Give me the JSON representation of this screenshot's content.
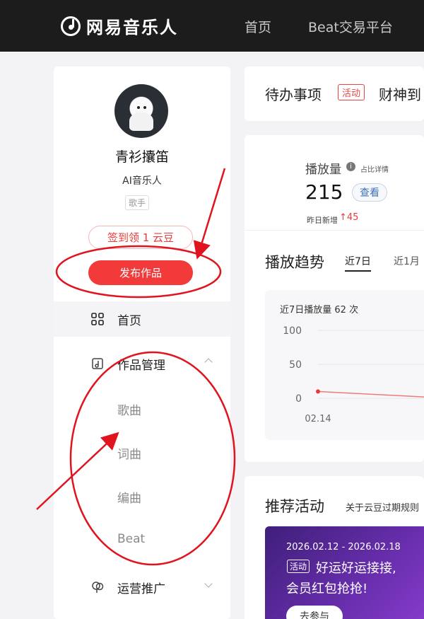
{
  "header": {
    "brand": "网易音乐人",
    "nav": [
      "首页",
      "Beat交易平台"
    ]
  },
  "profile": {
    "name": "青衫攮笛",
    "title": "AI音乐人",
    "role_tag": "歌手",
    "checkin_label": "签到领 1 云豆",
    "publish_label": "发布作品"
  },
  "menu": {
    "home": "首页",
    "works": "作品管理",
    "works_items": [
      "歌曲",
      "词曲",
      "编曲",
      "Beat"
    ],
    "promo": "运营推广"
  },
  "todo": {
    "title": "待办事项",
    "tag": "活动",
    "text": "财神到"
  },
  "stats": {
    "label": "播放量",
    "detail_link": "占比详情",
    "value": "215",
    "view_button": "查看",
    "yesterday_label": "昨日新增",
    "yesterday_value": "45"
  },
  "trend": {
    "title": "播放趋势",
    "tabs": [
      "近7日",
      "近1月"
    ],
    "caption": "近7日播放量 62 次"
  },
  "chart_data": {
    "type": "line",
    "title": "近7日播放量 62 次",
    "x": [
      "02.14"
    ],
    "series": [
      {
        "values": [
          10
        ]
      }
    ],
    "ylim": [
      0,
      100
    ],
    "yticks": [
      "100",
      "50",
      "0"
    ],
    "grid": true,
    "color": "#f07a7a"
  },
  "recommend": {
    "title": "推荐活动",
    "link": "关于云豆过期规则",
    "banner_date": "2026.02.12 - 2026.02.18",
    "banner_tag": "活动",
    "banner_line1": "好运好运接接,",
    "banner_line2": "会员红包抢抢!",
    "banner_button": "去参与"
  },
  "colors": {
    "accent": "#f23a3a",
    "annotation": "#e0141e",
    "header_bg": "#1c1c1c"
  }
}
